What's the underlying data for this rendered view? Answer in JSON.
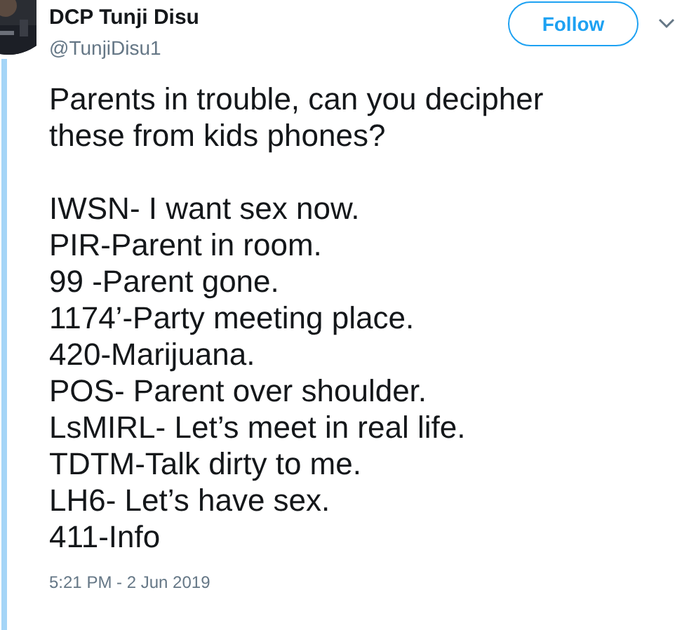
{
  "author": {
    "name": "DCP Tunji Disu",
    "handle": "@TunjiDisu1"
  },
  "follow_button": {
    "label": "Follow"
  },
  "tweet": {
    "intro": "Parents in trouble, can you decipher these from kids phones?",
    "lines": [
      "IWSN- I want sex now.",
      "PIR-Parent in room.",
      "99 -Parent gone.",
      "1174’-Party meeting place.",
      "420-Marijuana.",
      "POS- Parent over shoulder.",
      "LsMIRL- Let’s meet in real life.",
      "TDTM-Talk dirty to me.",
      "LH6- Let’s have sex.",
      "411-Info"
    ],
    "timestamp": "5:21 PM - 2 Jun 2019"
  }
}
